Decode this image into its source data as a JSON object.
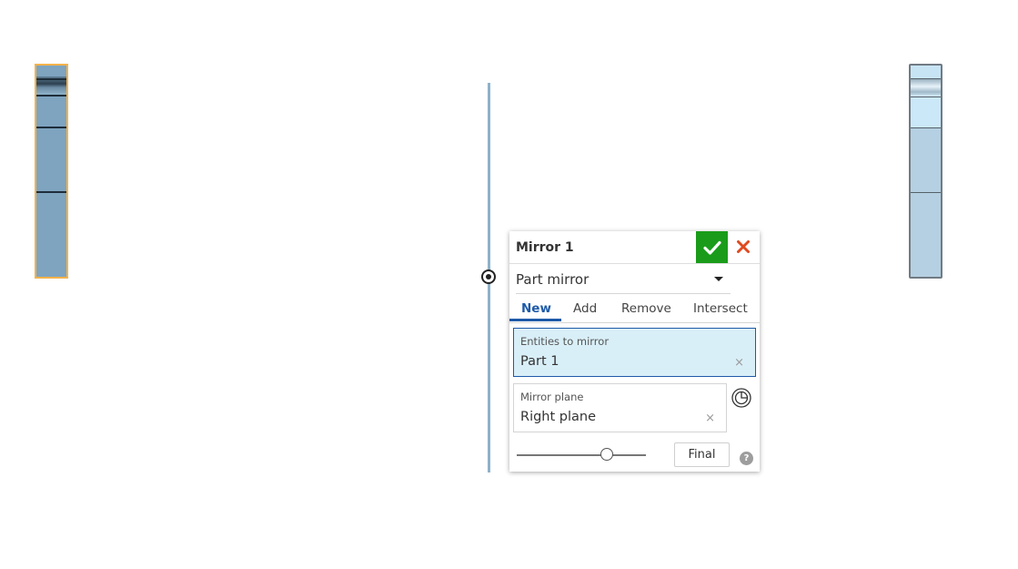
{
  "viewport": {
    "original_part": {
      "highlight_color": "#f3b24a",
      "fill_color": "#7ea4c0"
    },
    "mirrored_part": {
      "fill_color": "#b5d0e2"
    },
    "mirror_plane_color": "#8fb2c9",
    "plane_manipulator_icon": "target-icon"
  },
  "dialog": {
    "title": "Mirror 1",
    "accept_icon": "checkmark-icon",
    "accept_color": "#1a9c1a",
    "cancel_icon": "close-icon",
    "cancel_color": "#e04a1f",
    "mode": {
      "selected": "Part mirror"
    },
    "tabs": [
      {
        "label": "New",
        "active": true
      },
      {
        "label": "Add",
        "active": false
      },
      {
        "label": "Remove",
        "active": false
      },
      {
        "label": "Intersect",
        "active": false
      }
    ],
    "entities": {
      "label": "Entities to mirror",
      "value": "Part 1",
      "clear": "×"
    },
    "mirror_plane": {
      "label": "Mirror plane",
      "value": "Right plane",
      "clear": "×",
      "icon": "plane-select-icon"
    },
    "render_slider": {
      "level": 0.7
    },
    "final_button": "Final",
    "help": "?"
  }
}
